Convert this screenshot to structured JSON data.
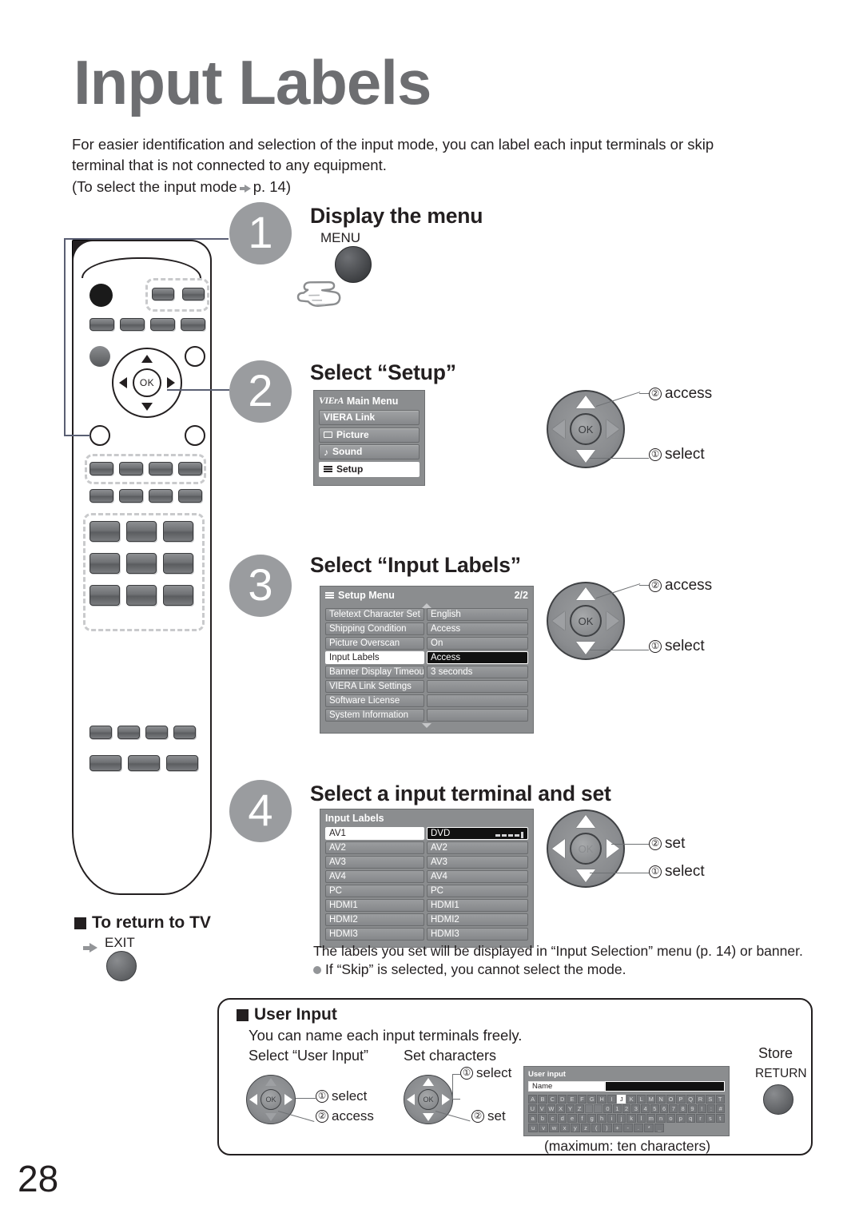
{
  "page": {
    "title": "Input Labels",
    "number": "28",
    "intro_line1": "For easier identification and selection of the input mode, you can label each input terminals or skip",
    "intro_line2": "terminal that is not connected to any equipment.",
    "intro_line3_pre": "(To select the input mode",
    "intro_line3_post": "p. 14)"
  },
  "steps": [
    {
      "num": "1",
      "title": "Display the menu"
    },
    {
      "num": "2",
      "title": "Select “Setup”"
    },
    {
      "num": "3",
      "title": "Select “Input Labels”"
    },
    {
      "num": "4",
      "title": "Select a input terminal and set"
    }
  ],
  "step1": {
    "button_label": "MENU"
  },
  "main_menu": {
    "brand": "VIErA",
    "title": "Main Menu",
    "items": [
      {
        "label": "VIERA Link",
        "icon": "none",
        "active": false
      },
      {
        "label": "Picture",
        "icon": "picture-icon",
        "active": false
      },
      {
        "label": "Sound",
        "icon": "sound-icon",
        "active": false
      },
      {
        "label": "Setup",
        "icon": "setup-list-icon",
        "active": true
      }
    ]
  },
  "setup_menu": {
    "title": "Setup Menu",
    "page_indicator": "2/2",
    "rows": [
      {
        "key": "Teletext Character Set",
        "value": "English",
        "selected": false
      },
      {
        "key": "Shipping Condition",
        "value": "Access",
        "selected": false
      },
      {
        "key": "Picture Overscan",
        "value": "On",
        "selected": false
      },
      {
        "key": "Input Labels",
        "value": "Access",
        "selected": true
      },
      {
        "key": "Banner Display Timeout",
        "value": "3 seconds",
        "selected": false
      },
      {
        "key": "VIERA Link Settings",
        "value": "",
        "selected": false
      },
      {
        "key": "Software License",
        "value": "",
        "selected": false
      },
      {
        "key": "System Information",
        "value": "",
        "selected": false
      }
    ]
  },
  "input_labels_menu": {
    "title": "Input Labels",
    "rows": [
      {
        "key": "AV1",
        "value": "DVD",
        "selected": true
      },
      {
        "key": "AV2",
        "value": "AV2",
        "selected": false
      },
      {
        "key": "AV3",
        "value": "AV3",
        "selected": false
      },
      {
        "key": "AV4",
        "value": "AV4",
        "selected": false
      },
      {
        "key": "PC",
        "value": "PC",
        "selected": false
      },
      {
        "key": "HDMI1",
        "value": "HDMI1",
        "selected": false
      },
      {
        "key": "HDMI2",
        "value": "HDMI2",
        "selected": false
      },
      {
        "key": "HDMI3",
        "value": "HDMI3",
        "selected": false
      }
    ]
  },
  "callouts": {
    "step2": [
      {
        "num": "②",
        "label": "access"
      },
      {
        "num": "①",
        "label": "select"
      }
    ],
    "step3": [
      {
        "num": "②",
        "label": "access"
      },
      {
        "num": "①",
        "label": "select"
      }
    ],
    "step4": [
      {
        "num": "②",
        "label": "set"
      },
      {
        "num": "①",
        "label": "select"
      }
    ],
    "ok_text": "OK"
  },
  "return_to_tv": {
    "heading": "To return to TV",
    "button_label": "EXIT"
  },
  "notes": {
    "line1": "The labels you set will be displayed in “Input Selection” menu (p. 14) or banner.",
    "line2": "If “Skip” is selected, you cannot select the mode."
  },
  "user_input": {
    "heading": "User Input",
    "subtitle": "You can name each input terminals freely.",
    "col1_title": "Select “User Input”",
    "col1_callouts": [
      {
        "num": "①",
        "label": "select"
      },
      {
        "num": "②",
        "label": "access"
      }
    ],
    "col2_title": "Set characters",
    "col2_callouts": [
      {
        "num": "①",
        "label": "select"
      },
      {
        "num": "②",
        "label": "set"
      }
    ],
    "store_title": "Store",
    "store_button": "RETURN",
    "caption": "(maximum: ten characters)",
    "osd": {
      "title": "User input",
      "name_label": "Name",
      "name_value": "",
      "selected_key": "J",
      "rows": [
        [
          "A",
          "B",
          "C",
          "D",
          "E",
          "F",
          "G",
          "H",
          "I",
          "J",
          "K",
          "L",
          "M",
          "N",
          "O",
          "P",
          "Q",
          "R",
          "S",
          "T"
        ],
        [
          "U",
          "V",
          "W",
          "X",
          "Y",
          "Z",
          "",
          "",
          "0",
          "1",
          "2",
          "3",
          "4",
          "5",
          "6",
          "7",
          "8",
          "9",
          "!",
          ":",
          "#"
        ],
        [
          "a",
          "b",
          "c",
          "d",
          "e",
          "f",
          "g",
          "h",
          "i",
          "j",
          "k",
          "l",
          "m",
          "n",
          "o",
          "p",
          "q",
          "r",
          "s",
          "t"
        ],
        [
          "u",
          "v",
          "w",
          "x",
          "y",
          "z",
          "(",
          ")",
          "+",
          "-",
          ".",
          "*",
          "_"
        ]
      ]
    }
  },
  "colors": {
    "title_grey": "#6d6e71",
    "step_circle": "#9a9c9f",
    "osd_bg": "#8b8d8f",
    "selected_label_bg": "#ffffff",
    "selected_value_bg": "#111111",
    "text": "#231f20"
  }
}
